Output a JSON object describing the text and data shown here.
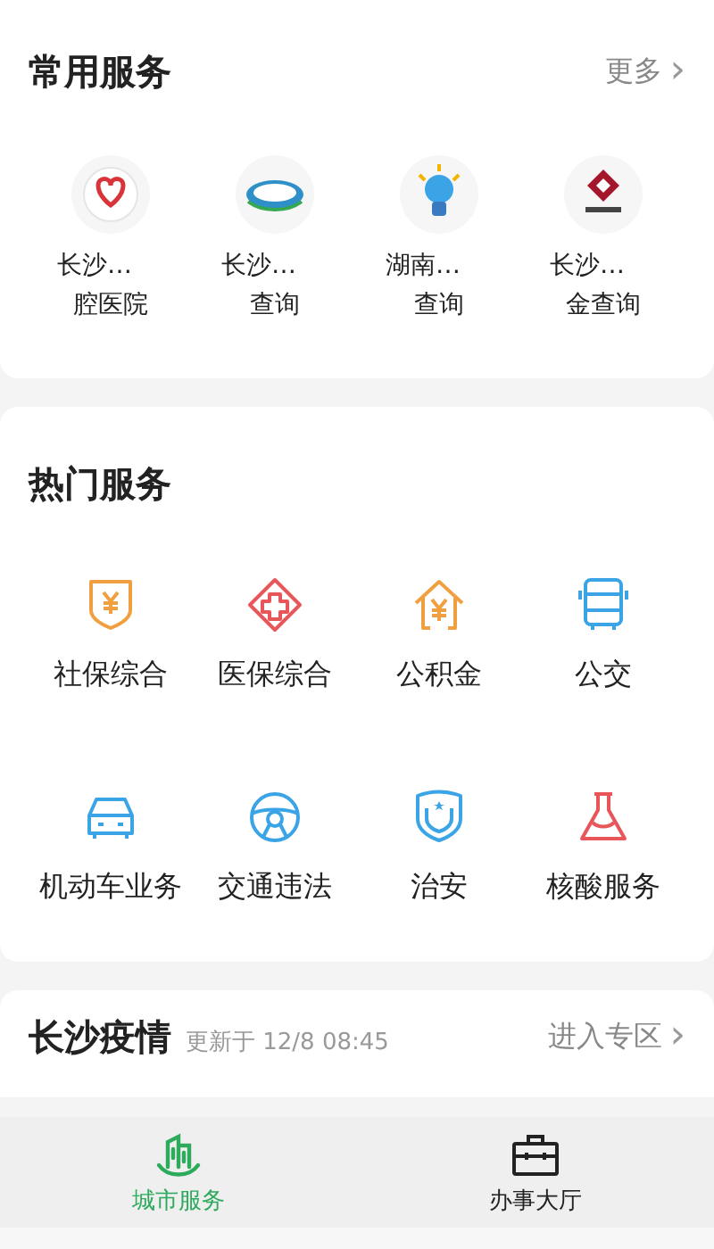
{
  "common_services": {
    "title": "常用服务",
    "more": "更多",
    "more_arrow": "›",
    "items": [
      {
        "line1": "长沙…",
        "line2": "腔医院"
      },
      {
        "line1": "长沙…",
        "line2": "查询"
      },
      {
        "line1": "湖南…",
        "line2": "查询"
      },
      {
        "line1": "长沙…",
        "line2": "金查询"
      }
    ]
  },
  "hot_services": {
    "title": "热门服务",
    "items": [
      {
        "label": "社保综合",
        "color": "#f0a040"
      },
      {
        "label": "医保综合",
        "color": "#e8565a"
      },
      {
        "label": "公积金",
        "color": "#f0a040"
      },
      {
        "label": "公交",
        "color": "#3aa4e6"
      },
      {
        "label": "机动车业务",
        "color": "#3aa4e6"
      },
      {
        "label": "交通违法",
        "color": "#3aa4e6"
      },
      {
        "label": "治安",
        "color": "#3aa4e6"
      },
      {
        "label": "核酸服务",
        "color": "#e8565a"
      }
    ]
  },
  "epidemic": {
    "title": "长沙疫情",
    "updated": "更新于 12/8 08:45",
    "link": "进入专区",
    "link_arrow": "›"
  },
  "tab_bar": [
    {
      "label": "城市服务",
      "selected": true
    },
    {
      "label": "办事大厅",
      "selected": false
    }
  ]
}
